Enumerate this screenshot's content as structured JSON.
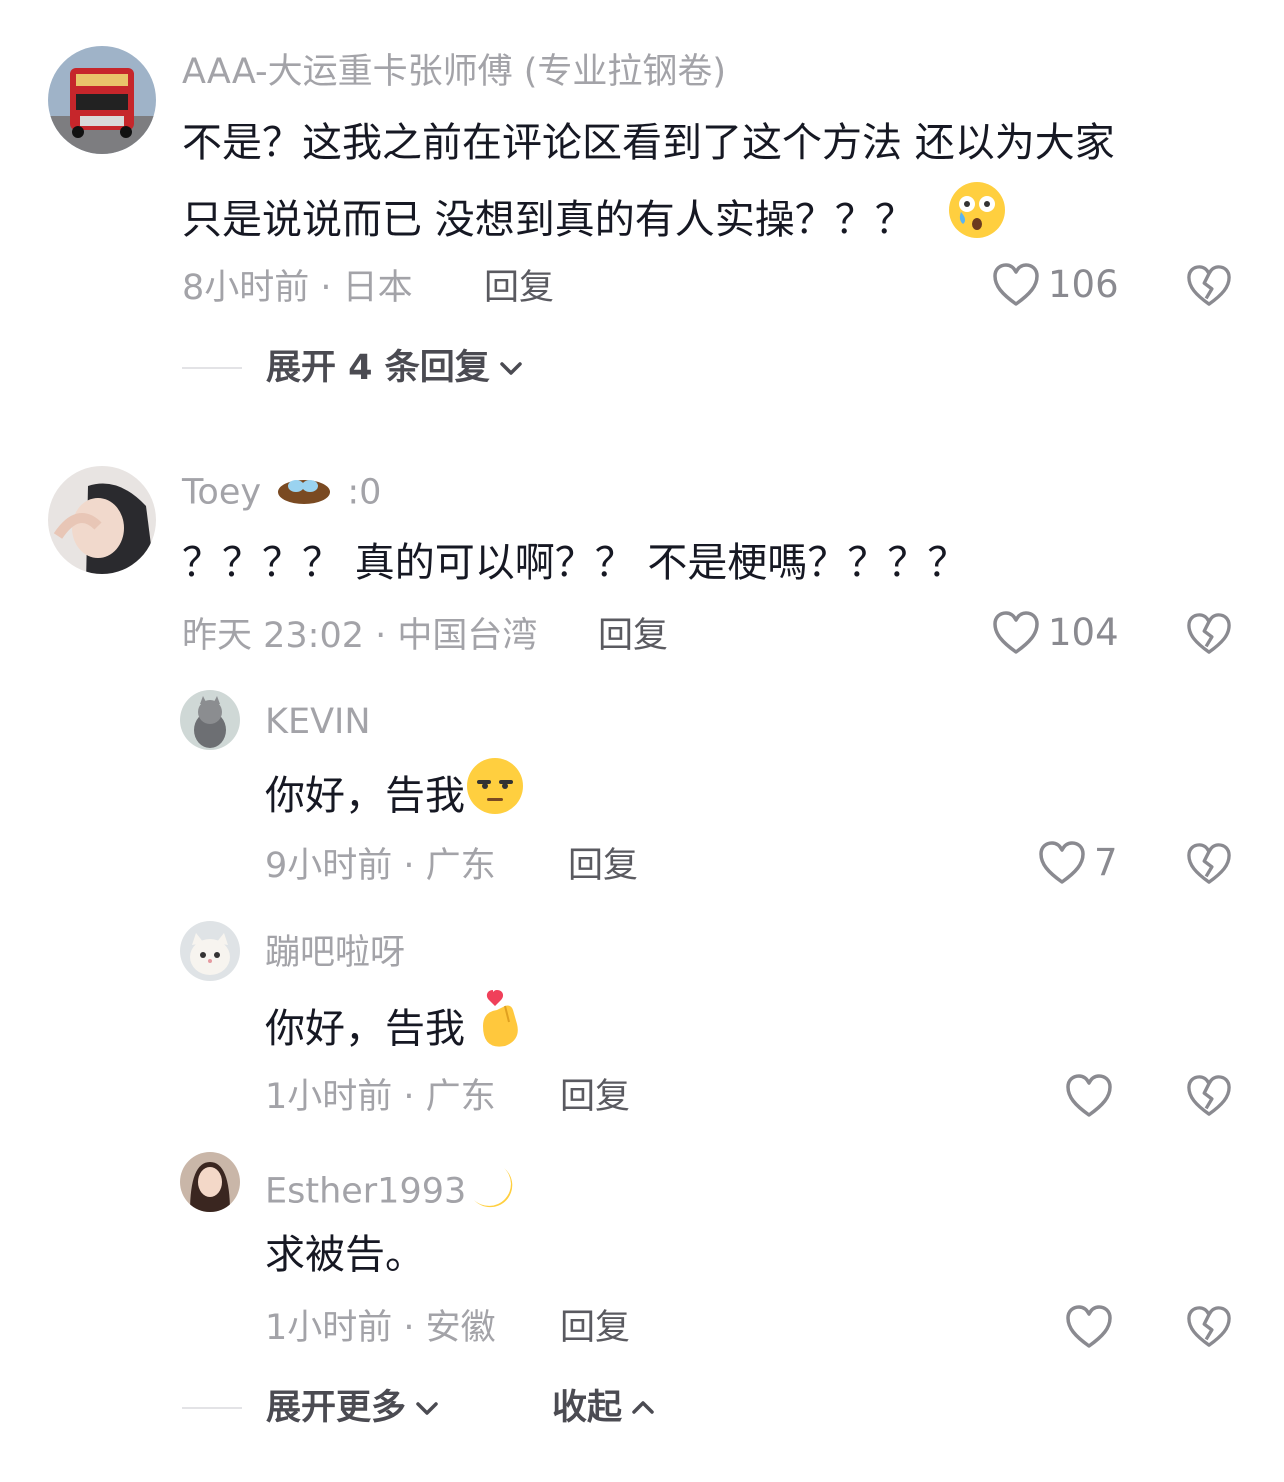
{
  "comments": [
    {
      "username": "AAA-大运重卡张师傅 (专业拉钢卷)",
      "text_line1": "不是？这我之前在评论区看到了这个方法 还以为大家",
      "text_line2": "只是说说而已 没想到真的有人实操？？？",
      "time_location": "8小时前 · 日本",
      "reply_label": "回复",
      "likes": "106",
      "expand_label": "展开 4 条回复"
    },
    {
      "username": "Toey",
      "username_suffix": ":0",
      "text": "？？？？ 真的可以啊？？ 不是梗嗎？？？？",
      "time_location": "昨天 23:02 · 中国台湾",
      "reply_label": "回复",
      "likes": "104",
      "replies": [
        {
          "username": "KEVIN",
          "text": "你好，告我",
          "time_location": "9小时前 · 广东",
          "reply_label": "回复",
          "likes": "7"
        },
        {
          "username": "蹦吧啦呀",
          "text": "你好，告我",
          "time_location": "1小时前 · 广东",
          "reply_label": "回复"
        },
        {
          "username": "Esther1993",
          "text": "求被告。",
          "time_location": "1小时前 · 安徽",
          "reply_label": "回复"
        }
      ],
      "expand_more_label": "展开更多",
      "collapse_label": "收起"
    }
  ],
  "icons": {
    "like": "heart-outline-icon",
    "dislike": "broken-heart-icon",
    "expand": "chevron-down-icon",
    "collapse": "chevron-up-icon"
  },
  "colors": {
    "text": "#161823",
    "secondary": "#a3a3a8",
    "action": "#5a5a60"
  }
}
